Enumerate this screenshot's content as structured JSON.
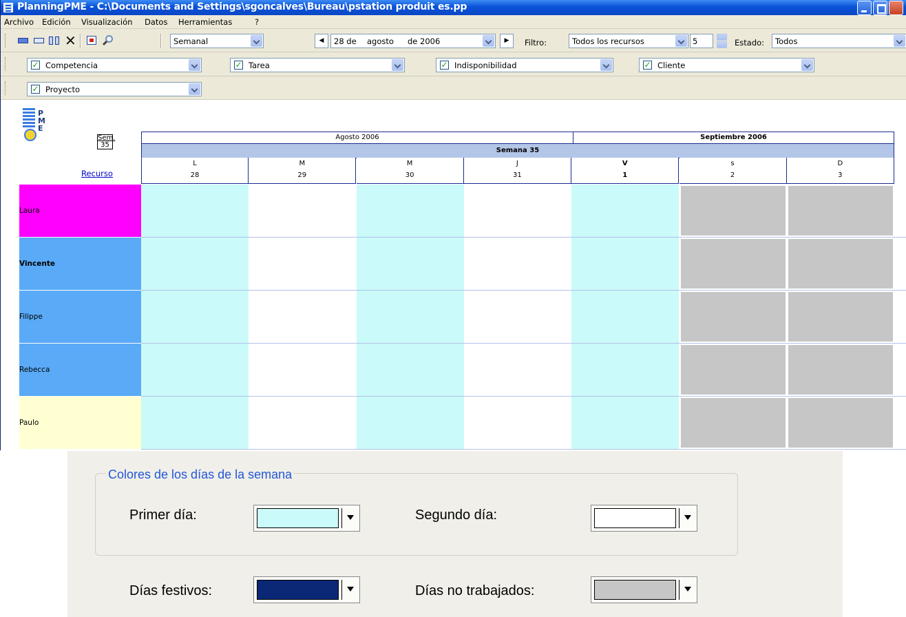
{
  "window": {
    "title": "PlanningPME - C:\\Documents and Settings\\sgoncalves\\Bureau\\pstation produit es.pp"
  },
  "menu": {
    "items": [
      {
        "label": "Archivo"
      },
      {
        "label": "Edición"
      },
      {
        "label": "Visualización"
      },
      {
        "label": "Datos"
      },
      {
        "label": "Herramientas"
      },
      {
        "label": "?"
      }
    ]
  },
  "toolbar": {
    "view_mode": "Semanal",
    "date_day": "28 de",
    "date_month": "agosto",
    "date_year": "de 2006",
    "filter_label": "Filtro:",
    "filter_value": "Todos los recursos",
    "count_value": "5",
    "estado_label": "Estado:",
    "estado_value": "Todos"
  },
  "filters": {
    "competencia": "Competencia",
    "tarea": "Tarea",
    "indisponibilidad": "Indisponibilidad",
    "cliente": "Cliente",
    "proyecto": "Proyecto"
  },
  "planning": {
    "sem_label": "Sem.",
    "sem_number": "35",
    "recurso_label": "Recurso",
    "month1": "Agosto 2006",
    "month2": "Septiembre 2006",
    "week_label": "Semana 35",
    "days": [
      {
        "letter": "L",
        "num": "28"
      },
      {
        "letter": "M",
        "num": "29"
      },
      {
        "letter": "M",
        "num": "30"
      },
      {
        "letter": "J",
        "num": "31"
      },
      {
        "letter": "V",
        "num": "1"
      },
      {
        "letter": "s",
        "num": "2"
      },
      {
        "letter": "D",
        "num": "3"
      }
    ],
    "resources": [
      {
        "name": "Laura",
        "color": "#ff00ff"
      },
      {
        "name": "Vincente",
        "color": "#5aaaf8"
      },
      {
        "name": "Filippe",
        "color": "#5aaaf8"
      },
      {
        "name": "Rebecca",
        "color": "#5aaaf8"
      },
      {
        "name": "Paulo",
        "color": "#ffffd2"
      }
    ]
  },
  "colors_dialog": {
    "group_title": "Colores de los días de la semana",
    "primer_dia_label": "Primer día:",
    "segundo_dia_label": "Segundo día:",
    "festivos_label": "Días festivos:",
    "no_trabajados_label": "Días no trabajados:",
    "primer_dia_color": "#cafaf9",
    "segundo_dia_color": "#ffffff",
    "festivos_color": "#0a2875",
    "no_trabajados_color": "#c6c6c6"
  }
}
